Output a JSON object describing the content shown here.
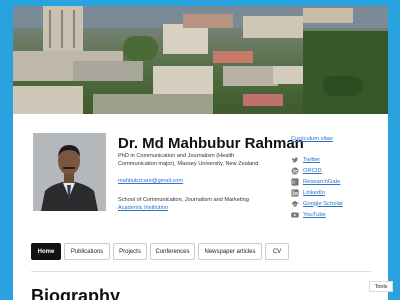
{
  "header": {
    "name": "Dr. Md Mahbubur Rahman",
    "degree_line1": "PhD in Communication and Journalism (Health",
    "degree_line2": "Communication major), Massey University, New Zealand",
    "email": "mahbubzcare@gmail.com",
    "school": "School of Communication, Journalism and Marketing",
    "institution_link": "Academic Institution"
  },
  "social": {
    "cv_link": "Curriculum vitae",
    "items": [
      {
        "label": "Twitter",
        "icon": "twitter-icon"
      },
      {
        "label": "ORCID",
        "icon": "orcid-icon"
      },
      {
        "label": "ResearchGate",
        "icon": "researchgate-icon"
      },
      {
        "label": "LinkedIn",
        "icon": "linkedin-icon"
      },
      {
        "label": "Google Scholar",
        "icon": "google-scholar-icon"
      },
      {
        "label": "YouTube",
        "icon": "youtube-icon"
      }
    ]
  },
  "nav": {
    "tabs": [
      {
        "label": "Home",
        "active": true
      },
      {
        "label": "Publications",
        "active": false
      },
      {
        "label": "Projects",
        "active": false
      },
      {
        "label": "Conferences",
        "active": false
      },
      {
        "label": "Newspaper articles",
        "active": false
      },
      {
        "label": "CV",
        "active": false
      }
    ]
  },
  "main": {
    "heading": "Biography"
  },
  "tools_button": "Tools",
  "colors": {
    "background": "#29a3e0",
    "link": "#2a73c9",
    "active_tab": "#111111"
  }
}
